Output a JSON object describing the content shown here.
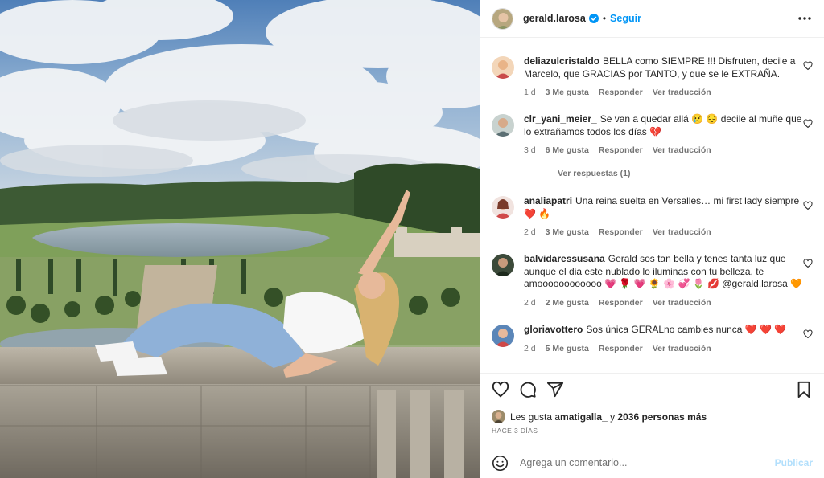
{
  "post": {
    "author": "gerald.larosa",
    "follow_label": "Seguir",
    "separator": "•",
    "likes_prefix": "Les gusta a ",
    "likes_user": "matigalla_",
    "likes_join": " y ",
    "likes_count": "2036 personas más",
    "date": "HACE 3 DÍAS",
    "add_comment_placeholder": "Agrega un comentario...",
    "publish_label": "Publicar"
  },
  "icons": {
    "more": "more-options-icon",
    "verified": "verified-badge-icon",
    "like": "heart-icon",
    "comment": "comment-icon",
    "share": "share-icon",
    "save": "bookmark-icon",
    "emoji": "emoji-icon"
  },
  "colors": {
    "accent": "#0095f6",
    "text": "#262626",
    "muted": "#737373",
    "heart": "#ed4956"
  },
  "comments": [
    {
      "user": "deliazulcristaldo",
      "text": "BELLA como SIEMPRE !!! Disfruten, decile a Marcelo, que GRACIAS por TANTO, y que se le EXTRAÑA.",
      "age": "1 d",
      "likes": "3 Me gusta",
      "reply": "Responder",
      "translate": "Ver traducción"
    },
    {
      "user": "clr_yani_meier_",
      "text": "Se van a quedar allá 😢 😔 decile al muñe que lo extrañamos todos los días 💔",
      "age": "3 d",
      "likes": "6 Me gusta",
      "reply": "Responder",
      "translate": "Ver traducción",
      "replies_label": "Ver respuestas (1)"
    },
    {
      "user": "analiapatri",
      "text": "Una reina suelta en Versalles… mi first lady siempre ❤️ 🔥",
      "age": "2 d",
      "likes": "3 Me gusta",
      "reply": "Responder",
      "translate": "Ver traducción"
    },
    {
      "user": "balvidaressusana",
      "text": "Gerald sos tan bella y tenes tanta luz que aunque el dia este nublado lo iluminas con tu belleza, te amoooooooooooo 💗 🌹 💗 🌻 🌸 💞 🌷 💋 @gerald.larosa 🧡",
      "age": "2 d",
      "likes": "2 Me gusta",
      "reply": "Responder",
      "translate": "Ver traducción"
    },
    {
      "user": "gloriavottero",
      "text": "Sos única GERALno cambies nunca ❤️ ❤️ ❤️",
      "age": "2 d",
      "likes": "5 Me gusta",
      "reply": "Responder",
      "translate": "Ver traducción"
    }
  ]
}
